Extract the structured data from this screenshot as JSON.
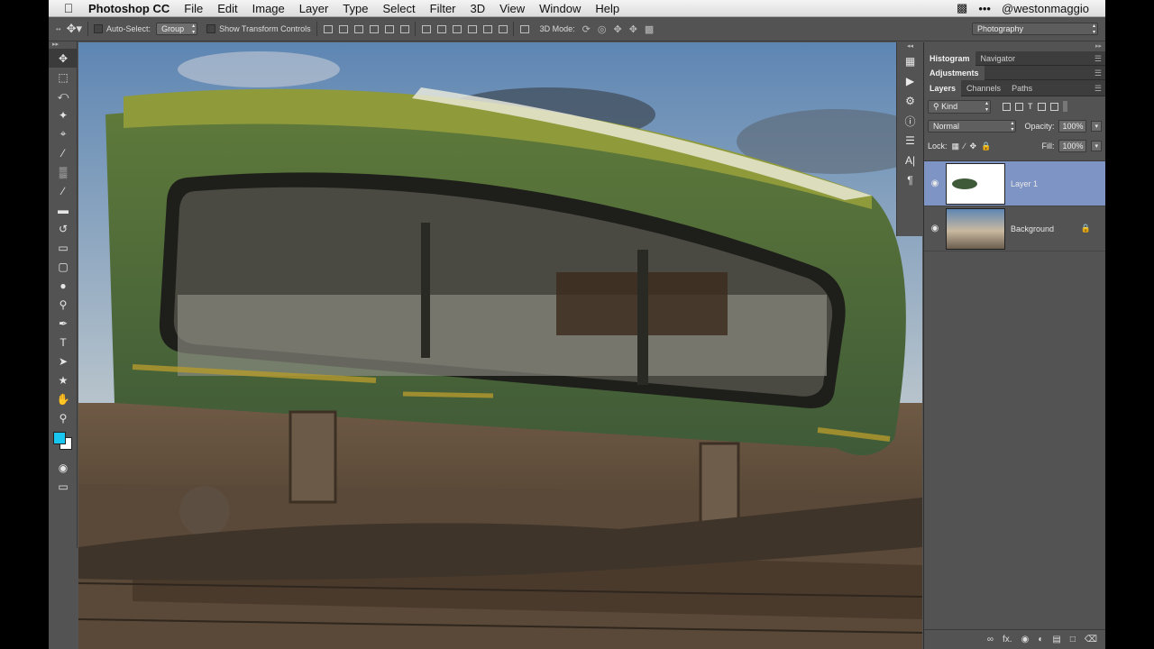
{
  "menubar": {
    "app_name": "Photoshop CC",
    "items": [
      "File",
      "Edit",
      "Image",
      "Layer",
      "Type",
      "Select",
      "Filter",
      "3D",
      "View",
      "Window",
      "Help"
    ],
    "user": "@westonmaggio",
    "icons": [
      "apple-icon",
      "screen-share-icon",
      "more-dots-icon"
    ]
  },
  "options_bar": {
    "auto_select_label": "Auto-Select:",
    "auto_select_value": "Group",
    "show_transform_label": "Show Transform Controls",
    "mode_3d_label": "3D Mode:",
    "workspace": "Photography"
  },
  "toolbox": {
    "tools": [
      "move-tool",
      "marquee-tool",
      "lasso-tool",
      "magic-wand-tool",
      "crop-tool",
      "eyedropper-tool",
      "healing-brush-tool",
      "brush-tool",
      "clone-stamp-tool",
      "history-brush-tool",
      "eraser-tool",
      "gradient-tool",
      "blur-tool",
      "dodge-tool",
      "pen-tool",
      "type-tool",
      "path-selection-tool",
      "custom-shape-tool",
      "hand-tool",
      "zoom-tool"
    ],
    "foreground_color": "#19c6ef",
    "background_color": "#ffffff"
  },
  "panels": {
    "top_tabs": [
      "Histogram",
      "Navigator"
    ],
    "adjustments_tab": "Adjustments",
    "layer_tabs": [
      "Layers",
      "Channels",
      "Paths"
    ],
    "filter_kind": "Kind",
    "blend_mode": "Normal",
    "opacity_label": "Opacity:",
    "opacity_value": "100%",
    "lock_label": "Lock:",
    "fill_label": "Fill:",
    "fill_value": "100%",
    "layers": [
      {
        "name": "Layer 1",
        "selected": true,
        "visible": true
      },
      {
        "name": "Background",
        "selected": false,
        "visible": true,
        "locked": true
      }
    ]
  },
  "colors": {
    "ui_bg": "#535353",
    "selection_accent": "#7d94c4",
    "menubar_bg": "#e8e8e8"
  }
}
